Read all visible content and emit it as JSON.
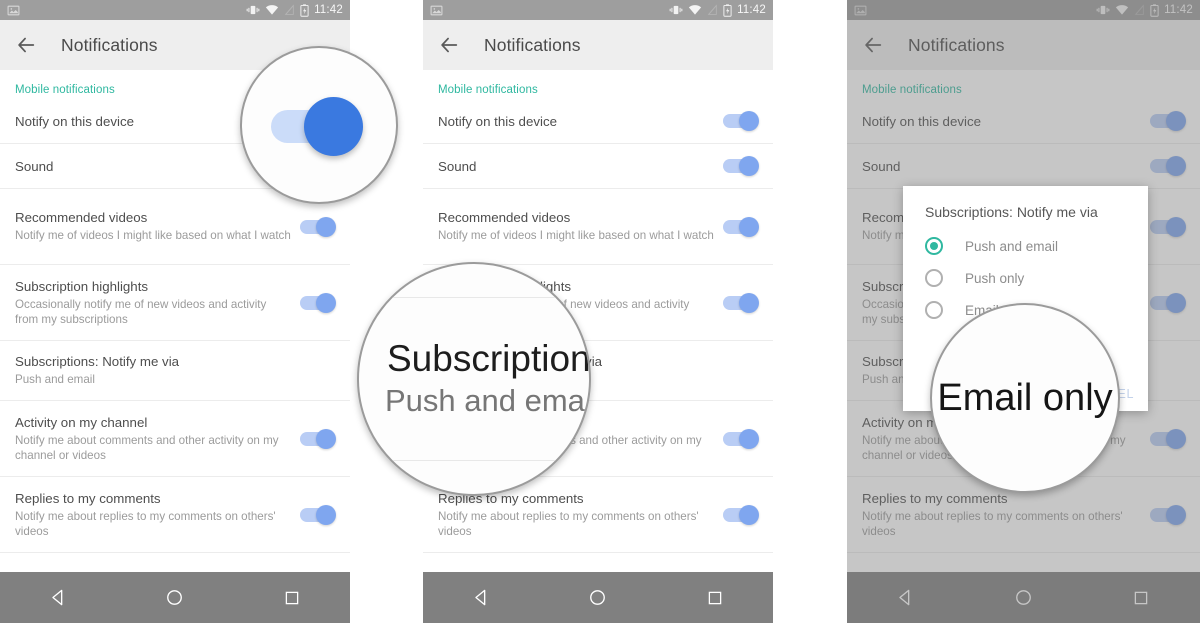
{
  "statusbar": {
    "time": "11:42",
    "icons": [
      "screenshot-icon",
      "vibrate-icon",
      "wifi-icon",
      "signal-off-icon",
      "battery-charging-icon"
    ]
  },
  "appbar": {
    "back_label": "back-arrow",
    "title": "Notifications"
  },
  "colors": {
    "accent_teal": "#2fb8a0",
    "toggle_on": "#7fa6ef",
    "toggle_track": "#b9cdf5",
    "magnified_toggle": "#3a79e0",
    "statusbar": "#9e9e9e",
    "appbar": "#eeeeee",
    "navbar": "#808080"
  },
  "list": {
    "section_label": "Mobile notifications",
    "rows": [
      {
        "title": "Notify on this device",
        "subtitle": "",
        "toggle": "on"
      },
      {
        "title": "Sound",
        "subtitle": "",
        "toggle": "on"
      },
      {
        "title": "Recommended videos",
        "subtitle": "Notify me of videos I might like based on what I watch",
        "toggle": "on"
      },
      {
        "title": "Subscription highlights",
        "subtitle": "Occasionally notify me of new videos and activity from my subscriptions",
        "toggle": "on"
      },
      {
        "title": "Subscriptions: Notify me via",
        "subtitle": "Push and email",
        "toggle": "none"
      },
      {
        "title": "Activity on my channel",
        "subtitle": "Notify me about comments and other activity on my channel or videos",
        "toggle": "on"
      },
      {
        "title": "Replies to my comments",
        "subtitle": "Notify me about replies to my comments on others' videos",
        "toggle": "on"
      }
    ]
  },
  "navbar": {
    "back": "nav-back-triangle",
    "home": "nav-home-circle",
    "recents": "nav-recents-square"
  },
  "dialog": {
    "title": "Subscriptions: Notify me via",
    "options": [
      {
        "label": "Push and email",
        "selected": true
      },
      {
        "label": "Push only",
        "selected": false
      },
      {
        "label": "Email only",
        "selected": false
      }
    ],
    "cancel_label": "CANCEL"
  },
  "magnifiers": {
    "one": {
      "content": "toggle-switch-on",
      "panel": 1
    },
    "two": {
      "line1": "Subscription",
      "line2": "Push and ema",
      "panel": 2
    },
    "three": {
      "line1": "Email only",
      "panel": 3
    }
  }
}
